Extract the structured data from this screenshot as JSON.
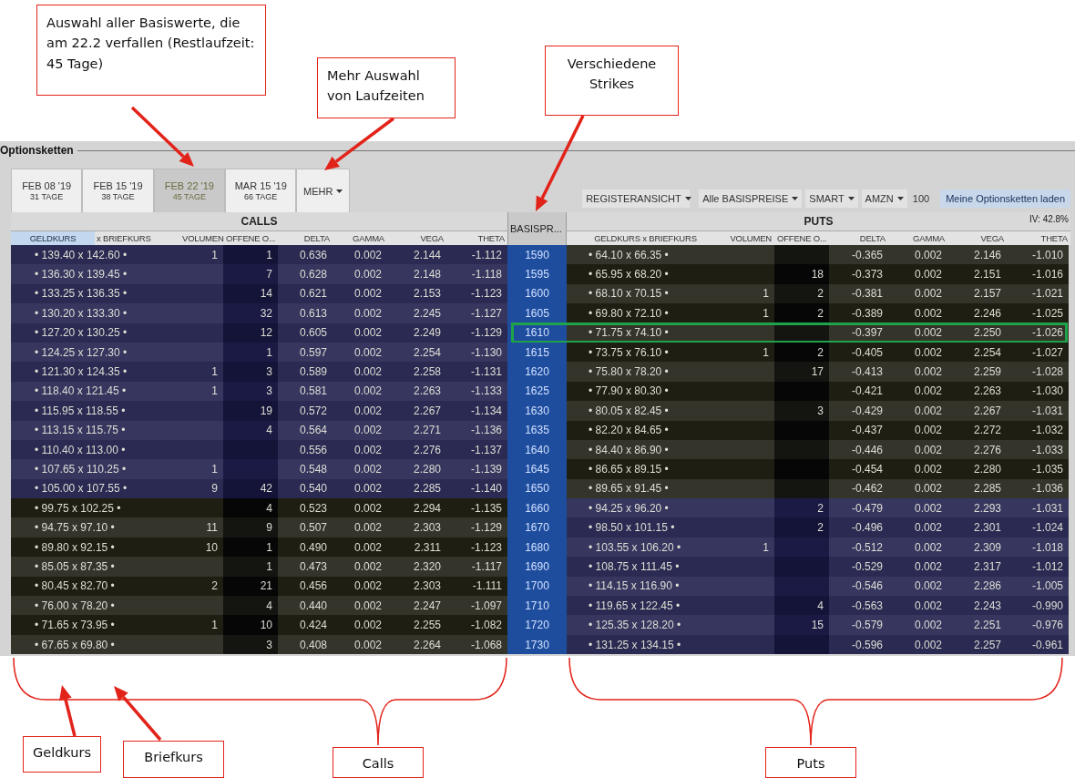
{
  "callouts_top": [
    "Auswahl aller Basiswerte, die am 22.2 verfallen (Restlaufzeit: 45 Tage)",
    "Mehr Auswahl von Laufzeiten",
    "Verschiedene Strikes"
  ],
  "panel": {
    "title": "Optionsketten",
    "tabs": [
      {
        "date": "FEB 08 '19",
        "days": "31 TAGE",
        "selected": false
      },
      {
        "date": "FEB 15 '19",
        "days": "38 TAGE",
        "selected": false
      },
      {
        "date": "FEB 22 '19",
        "days": "45 TAGE",
        "selected": true
      },
      {
        "date": "MAR 15 '19",
        "days": "66 TAGE",
        "selected": false
      }
    ],
    "more": "MEHR",
    "dropdowns": [
      "REGISTERANSICHT",
      "Alle BASISPREISE",
      "SMART",
      "AMZN"
    ],
    "multiplier": "100",
    "load_button": "Meine Optionsketten laden",
    "calls_title": "CALLS",
    "puts_title": "PUTS",
    "iv": "IV: 42.8%",
    "strike_header": "BASISPR...",
    "calls_columns": [
      {
        "label": "GELDKURS",
        "selected": true
      },
      {
        "label": "x  BRIEFKURS",
        "selected": false
      },
      {
        "label": "VOLUMEN",
        "selected": false
      },
      {
        "label": "OFFENE O...",
        "selected": false
      },
      {
        "label": "DELTA",
        "selected": false
      },
      {
        "label": "GAMMA",
        "selected": false
      },
      {
        "label": "VEGA",
        "selected": false
      },
      {
        "label": "THETA",
        "selected": false
      }
    ],
    "puts_columns": [
      {
        "label": "GELDKURS x  BRIEFKURS",
        "selected": false
      },
      {
        "label": "VOLUMEN",
        "selected": false
      },
      {
        "label": "OFFENE O...",
        "selected": false
      },
      {
        "label": "DELTA",
        "selected": false
      },
      {
        "label": "GAMMA",
        "selected": false
      },
      {
        "label": "VEGA",
        "selected": false
      },
      {
        "label": "THETA",
        "selected": false
      }
    ]
  },
  "rows": [
    {
      "strike": "1590",
      "highlighted": false,
      "call": {
        "itm": true,
        "quote": "• 139.40 x 142.60 •",
        "volume": "1",
        "open_interest": "1",
        "delta": "0.636",
        "gamma": "0.002",
        "vega": "2.144",
        "theta": "-1.112"
      },
      "put": {
        "itm": false,
        "quote": "• 64.10 x 66.35 •",
        "delta": "-0.365",
        "gamma": "0.002",
        "vega": "2.146",
        "theta": "-1.010"
      }
    },
    {
      "strike": "1595",
      "highlighted": false,
      "call": {
        "itm": true,
        "quote": "• 136.30 x 139.45 •",
        "open_interest": "7",
        "delta": "0.628",
        "gamma": "0.002",
        "vega": "2.148",
        "theta": "-1.118"
      },
      "put": {
        "itm": false,
        "quote": "• 65.95 x 68.20 •",
        "open_interest": "18",
        "delta": "-0.373",
        "gamma": "0.002",
        "vega": "2.151",
        "theta": "-1.016"
      }
    },
    {
      "strike": "1600",
      "highlighted": false,
      "call": {
        "itm": true,
        "quote": "• 133.25 x 136.35 •",
        "open_interest": "14",
        "delta": "0.621",
        "gamma": "0.002",
        "vega": "2.153",
        "theta": "-1.123"
      },
      "put": {
        "itm": false,
        "quote": "• 68.10 x 70.15 •",
        "volume": "1",
        "open_interest": "2",
        "delta": "-0.381",
        "gamma": "0.002",
        "vega": "2.157",
        "theta": "-1.021"
      }
    },
    {
      "strike": "1605",
      "highlighted": false,
      "call": {
        "itm": true,
        "quote": "• 130.20 x 133.30 •",
        "open_interest": "32",
        "delta": "0.613",
        "gamma": "0.002",
        "vega": "2.245",
        "theta": "-1.127"
      },
      "put": {
        "itm": false,
        "quote": "• 69.80 x 72.10 •",
        "volume": "1",
        "open_interest": "2",
        "delta": "-0.389",
        "gamma": "0.002",
        "vega": "2.246",
        "theta": "-1.025"
      }
    },
    {
      "strike": "1610",
      "highlighted": true,
      "call": {
        "itm": true,
        "quote": "• 127.20 x 130.25 •",
        "open_interest": "12",
        "delta": "0.605",
        "gamma": "0.002",
        "vega": "2.249",
        "theta": "-1.129"
      },
      "put": {
        "itm": false,
        "quote": "• 71.75 x 74.10 •",
        "delta": "-0.397",
        "gamma": "0.002",
        "vega": "2.250",
        "theta": "-1.026"
      }
    },
    {
      "strike": "1615",
      "highlighted": false,
      "call": {
        "itm": true,
        "quote": "• 124.25 x 127.30 •",
        "open_interest": "1",
        "delta": "0.597",
        "gamma": "0.002",
        "vega": "2.254",
        "theta": "-1.130"
      },
      "put": {
        "itm": false,
        "quote": "• 73.75 x 76.10 •",
        "volume": "1",
        "open_interest": "2",
        "delta": "-0.405",
        "gamma": "0.002",
        "vega": "2.254",
        "theta": "-1.027"
      }
    },
    {
      "strike": "1620",
      "highlighted": false,
      "call": {
        "itm": true,
        "quote": "• 121.30 x 124.35 •",
        "volume": "1",
        "open_interest": "3",
        "delta": "0.589",
        "gamma": "0.002",
        "vega": "2.258",
        "theta": "-1.131"
      },
      "put": {
        "itm": false,
        "quote": "• 75.80 x 78.20 •",
        "open_interest": "17",
        "delta": "-0.413",
        "gamma": "0.002",
        "vega": "2.259",
        "theta": "-1.028"
      }
    },
    {
      "strike": "1625",
      "highlighted": false,
      "call": {
        "itm": true,
        "quote": "• 118.40 x 121.45 •",
        "volume": "1",
        "open_interest": "3",
        "delta": "0.581",
        "gamma": "0.002",
        "vega": "2.263",
        "theta": "-1.133"
      },
      "put": {
        "itm": false,
        "quote": "• 77.90 x 80.30 •",
        "delta": "-0.421",
        "gamma": "0.002",
        "vega": "2.263",
        "theta": "-1.030"
      }
    },
    {
      "strike": "1630",
      "highlighted": false,
      "call": {
        "itm": true,
        "quote": "• 115.95 x 118.55 •",
        "open_interest": "19",
        "delta": "0.572",
        "gamma": "0.002",
        "vega": "2.267",
        "theta": "-1.134"
      },
      "put": {
        "itm": false,
        "quote": "• 80.05 x 82.45 •",
        "open_interest": "3",
        "delta": "-0.429",
        "gamma": "0.002",
        "vega": "2.267",
        "theta": "-1.031"
      }
    },
    {
      "strike": "1635",
      "highlighted": false,
      "call": {
        "itm": true,
        "quote": "• 113.15 x 115.75 •",
        "open_interest": "4",
        "delta": "0.564",
        "gamma": "0.002",
        "vega": "2.271",
        "theta": "-1.136"
      },
      "put": {
        "itm": false,
        "quote": "• 82.20 x 84.65 •",
        "delta": "-0.437",
        "gamma": "0.002",
        "vega": "2.272",
        "theta": "-1.032"
      }
    },
    {
      "strike": "1640",
      "highlighted": false,
      "call": {
        "itm": true,
        "quote": "• 110.40 x 113.00 •",
        "delta": "0.556",
        "gamma": "0.002",
        "vega": "2.276",
        "theta": "-1.137"
      },
      "put": {
        "itm": false,
        "quote": "• 84.40 x 86.90 •",
        "delta": "-0.446",
        "gamma": "0.002",
        "vega": "2.276",
        "theta": "-1.033"
      }
    },
    {
      "strike": "1645",
      "highlighted": false,
      "call": {
        "itm": true,
        "quote": "• 107.65 x 110.25 •",
        "volume": "1",
        "delta": "0.548",
        "gamma": "0.002",
        "vega": "2.280",
        "theta": "-1.139"
      },
      "put": {
        "itm": false,
        "quote": "• 86.65 x 89.15 •",
        "delta": "-0.454",
        "gamma": "0.002",
        "vega": "2.280",
        "theta": "-1.035"
      }
    },
    {
      "strike": "1650",
      "highlighted": false,
      "call": {
        "itm": true,
        "quote": "• 105.00 x 107.55 •",
        "volume": "9",
        "open_interest": "42",
        "delta": "0.540",
        "gamma": "0.002",
        "vega": "2.285",
        "theta": "-1.140"
      },
      "put": {
        "itm": false,
        "quote": "• 89.65 x 91.45 •",
        "delta": "-0.462",
        "gamma": "0.002",
        "vega": "2.285",
        "theta": "-1.036"
      }
    },
    {
      "strike": "1660",
      "highlighted": false,
      "call": {
        "itm": false,
        "quote": "• 99.75 x 102.25 •",
        "open_interest": "4",
        "delta": "0.523",
        "gamma": "0.002",
        "vega": "2.294",
        "theta": "-1.135"
      },
      "put": {
        "itm": true,
        "quote": "• 94.25 x 96.20 •",
        "open_interest": "2",
        "delta": "-0.479",
        "gamma": "0.002",
        "vega": "2.293",
        "theta": "-1.031"
      }
    },
    {
      "strike": "1670",
      "highlighted": false,
      "call": {
        "itm": false,
        "quote": "• 94.75 x 97.10 •",
        "volume": "11",
        "open_interest": "9",
        "delta": "0.507",
        "gamma": "0.002",
        "vega": "2.303",
        "theta": "-1.129"
      },
      "put": {
        "itm": true,
        "quote": "• 98.50 x 101.15 •",
        "open_interest": "2",
        "delta": "-0.496",
        "gamma": "0.002",
        "vega": "2.301",
        "theta": "-1.024"
      }
    },
    {
      "strike": "1680",
      "highlighted": false,
      "call": {
        "itm": false,
        "quote": "• 89.80 x 92.15 •",
        "volume": "10",
        "open_interest": "1",
        "delta": "0.490",
        "gamma": "0.002",
        "vega": "2.311",
        "theta": "-1.123"
      },
      "put": {
        "itm": true,
        "quote": "• 103.55 x 106.20 •",
        "volume": "1",
        "delta": "-0.512",
        "gamma": "0.002",
        "vega": "2.309",
        "theta": "-1.018"
      }
    },
    {
      "strike": "1690",
      "highlighted": false,
      "call": {
        "itm": false,
        "quote": "• 85.05 x 87.35 •",
        "open_interest": "1",
        "delta": "0.473",
        "gamma": "0.002",
        "vega": "2.320",
        "theta": "-1.117"
      },
      "put": {
        "itm": true,
        "quote": "• 108.75 x 111.45 •",
        "delta": "-0.529",
        "gamma": "0.002",
        "vega": "2.317",
        "theta": "-1.012"
      }
    },
    {
      "strike": "1700",
      "highlighted": false,
      "call": {
        "itm": false,
        "quote": "• 80.45 x 82.70 •",
        "volume": "2",
        "open_interest": "21",
        "delta": "0.456",
        "gamma": "0.002",
        "vega": "2.303",
        "theta": "-1.111"
      },
      "put": {
        "itm": true,
        "quote": "• 114.15 x 116.90 •",
        "delta": "-0.546",
        "gamma": "0.002",
        "vega": "2.286",
        "theta": "-1.005"
      }
    },
    {
      "strike": "1710",
      "highlighted": false,
      "call": {
        "itm": false,
        "quote": "• 76.00 x 78.20 •",
        "open_interest": "4",
        "delta": "0.440",
        "gamma": "0.002",
        "vega": "2.247",
        "theta": "-1.097"
      },
      "put": {
        "itm": true,
        "quote": "• 119.65 x 122.45 •",
        "open_interest": "4",
        "delta": "-0.563",
        "gamma": "0.002",
        "vega": "2.243",
        "theta": "-0.990"
      }
    },
    {
      "strike": "1720",
      "highlighted": false,
      "call": {
        "itm": false,
        "quote": "• 71.65 x 73.95 •",
        "volume": "1",
        "open_interest": "10",
        "delta": "0.424",
        "gamma": "0.002",
        "vega": "2.255",
        "theta": "-1.082"
      },
      "put": {
        "itm": true,
        "quote": "• 125.35 x 128.20 •",
        "open_interest": "15",
        "delta": "-0.579",
        "gamma": "0.002",
        "vega": "2.251",
        "theta": "-0.976"
      }
    },
    {
      "strike": "1730",
      "highlighted": false,
      "call": {
        "itm": false,
        "quote": "• 67.65 x 69.80 •",
        "open_interest": "3",
        "delta": "0.408",
        "gamma": "0.002",
        "vega": "2.264",
        "theta": "-1.068"
      },
      "put": {
        "itm": true,
        "quote": "• 131.25 x 134.15 •",
        "delta": "-0.596",
        "gamma": "0.002",
        "vega": "2.257",
        "theta": "-0.961"
      }
    }
  ],
  "callouts_bottom": [
    "Geldkurs",
    "Briefkurs",
    "Calls",
    "Puts"
  ]
}
